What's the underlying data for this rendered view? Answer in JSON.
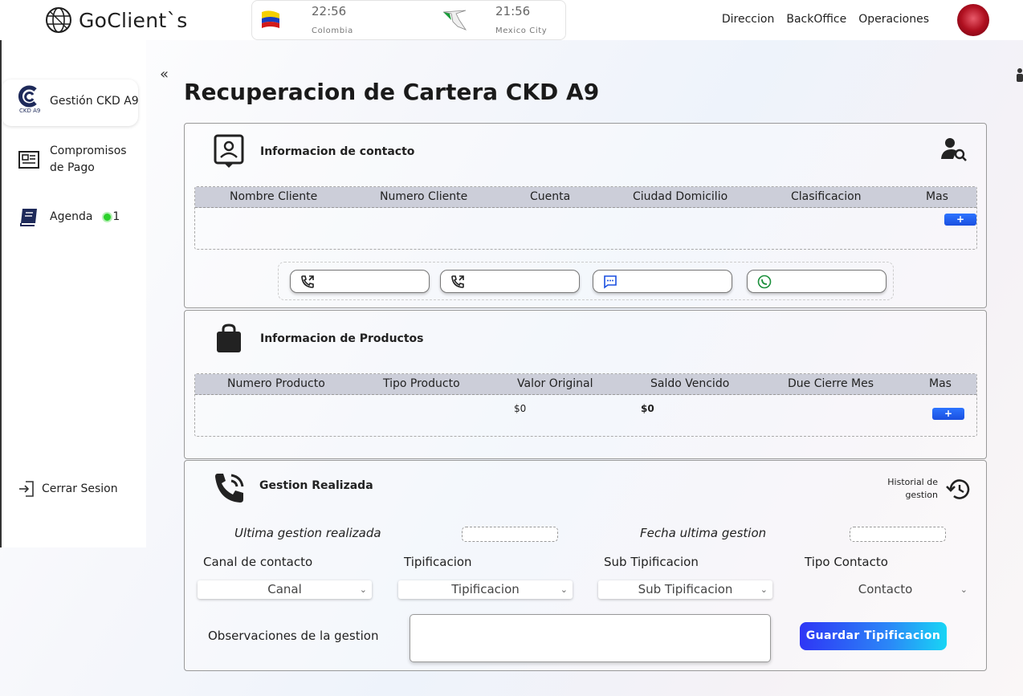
{
  "header": {
    "brand": "GoClient`s",
    "clocks": [
      {
        "time": "22:56",
        "city": "Colombia"
      },
      {
        "time": "21:56",
        "city": "Mexico City"
      }
    ],
    "nav": [
      "Direccion",
      "BackOffice",
      "Operaciones"
    ]
  },
  "sidebar": {
    "collapse_icon": "«",
    "items": [
      {
        "label": "Gestión CKD A9",
        "logo_text": "CKD A9"
      },
      {
        "label": "Compromisos de Pago"
      },
      {
        "label": "Agenda",
        "badge": "1"
      }
    ],
    "logout": "Cerrar Sesion"
  },
  "page": {
    "title": "Recuperacion de Cartera CKD A9"
  },
  "contact": {
    "title": "Informacion de contacto",
    "columns": [
      "Nombre Cliente",
      "Numero Cliente",
      "Cuenta",
      "Ciudad Domicilio",
      "Clasificacion",
      "Mas"
    ],
    "add_label": "+"
  },
  "products": {
    "title": "Informacion de Productos",
    "columns": [
      "Numero Producto",
      "Tipo Producto",
      "Valor Original",
      "Saldo Vencido",
      "Due Cierre Mes",
      "Mas"
    ],
    "valor_original": "$0",
    "saldo_vencido": "$0",
    "add_label": "+"
  },
  "gestion": {
    "title": "Gestion Realizada",
    "historial_line1": "Historial de",
    "historial_line2": "gestion",
    "ultima_label": "Ultima gestion realizada",
    "fecha_label": "Fecha ultima gestion",
    "canal_label": "Canal de contacto",
    "tipificacion_label": "Tipificacion",
    "sub_label": "Sub Tipificacion",
    "tipo_label": "Tipo Contacto",
    "canal_value": "Canal",
    "tipificacion_value": "Tipificacion",
    "sub_value": "Sub Tipificacion",
    "tipo_value": "Contacto",
    "obs_label": "Observaciones de la gestion",
    "save_label": "Guardar Tipificacion"
  },
  "colors": {
    "accent_blue": "#1a4fe0",
    "badge_green": "#2bd12b",
    "header_gray": "#ccced9"
  }
}
